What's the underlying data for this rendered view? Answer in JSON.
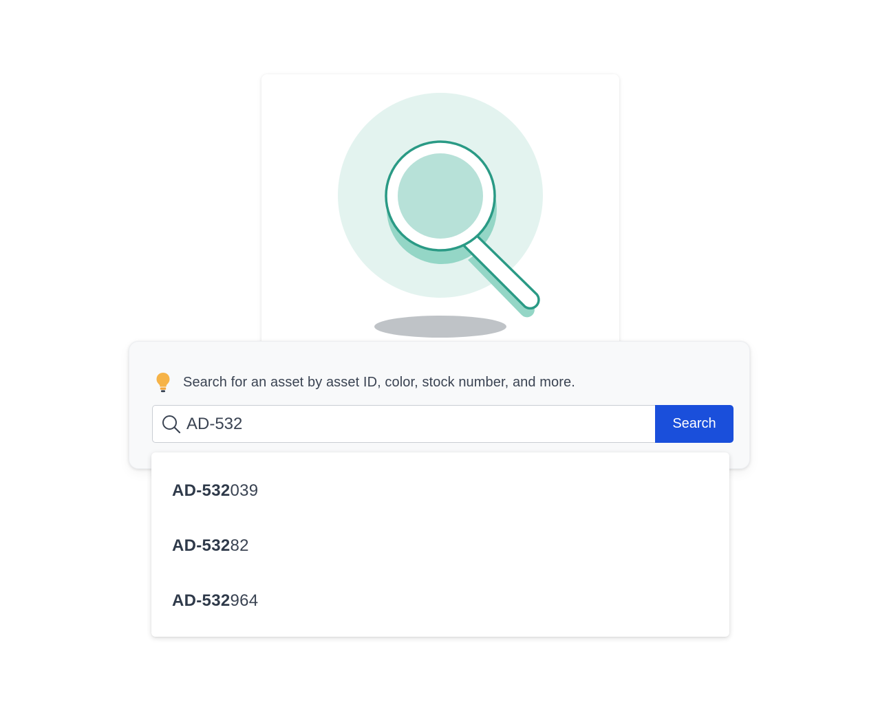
{
  "hint": {
    "icon": "lightbulb-icon",
    "text": "Search for an asset by asset ID, color, stock number, and more."
  },
  "search": {
    "icon": "search-icon",
    "value": "AD-532",
    "placeholder": "",
    "button_label": "Search"
  },
  "suggestions": [
    {
      "match": "AD-532",
      "rest": "039"
    },
    {
      "match": "AD-532",
      "rest": "82"
    },
    {
      "match": "AD-532",
      "rest": "964"
    }
  ],
  "colors": {
    "accent": "#1a4fdb",
    "illustration_teal": "#2a9a85",
    "illustration_circle": "#e3f3ef",
    "lightbulb": "#f6b347"
  }
}
